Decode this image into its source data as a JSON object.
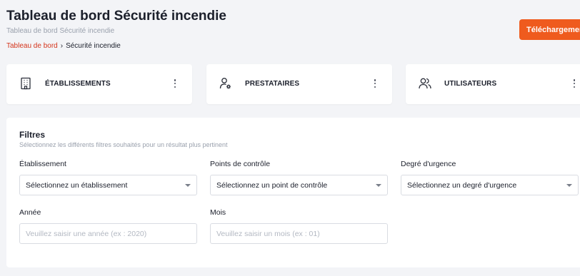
{
  "header": {
    "title": "Tableau de bord Sécurité incendie",
    "subtitle": "Tableau de bord Sécurité incendie",
    "download_label": "Téléchargement"
  },
  "breadcrumb": {
    "link": "Tableau de bord",
    "separator": "›",
    "current": "Sécurité incendie"
  },
  "cards": [
    {
      "label": "ÉTABLISSEMENTS",
      "icon": "building-icon"
    },
    {
      "label": "PRESTATAIRES",
      "icon": "user-gear-icon"
    },
    {
      "label": "UTILISATEURS",
      "icon": "users-icon"
    }
  ],
  "filters": {
    "title": "Filtres",
    "description": "Sélectionnez les différents filtres souhaités pour un résultat plus pertinent",
    "etablissement": {
      "label": "Établissement",
      "value": "Sélectionnez un établissement"
    },
    "points": {
      "label": "Points de contrôle",
      "value": "Sélectionnez un point de contrôle"
    },
    "urgence": {
      "label": "Degré d'urgence",
      "value": "Sélectionnez un degré d'urgence"
    },
    "annee": {
      "label": "Année",
      "placeholder": "Veuillez saisir une année (ex : 2020)"
    },
    "mois": {
      "label": "Mois",
      "placeholder": "Veuillez saisir un mois (ex : 01)"
    }
  },
  "colors": {
    "accent": "#ef5b1e",
    "breadcrumb_link": "#d4351c",
    "background": "#f3f4f7"
  }
}
